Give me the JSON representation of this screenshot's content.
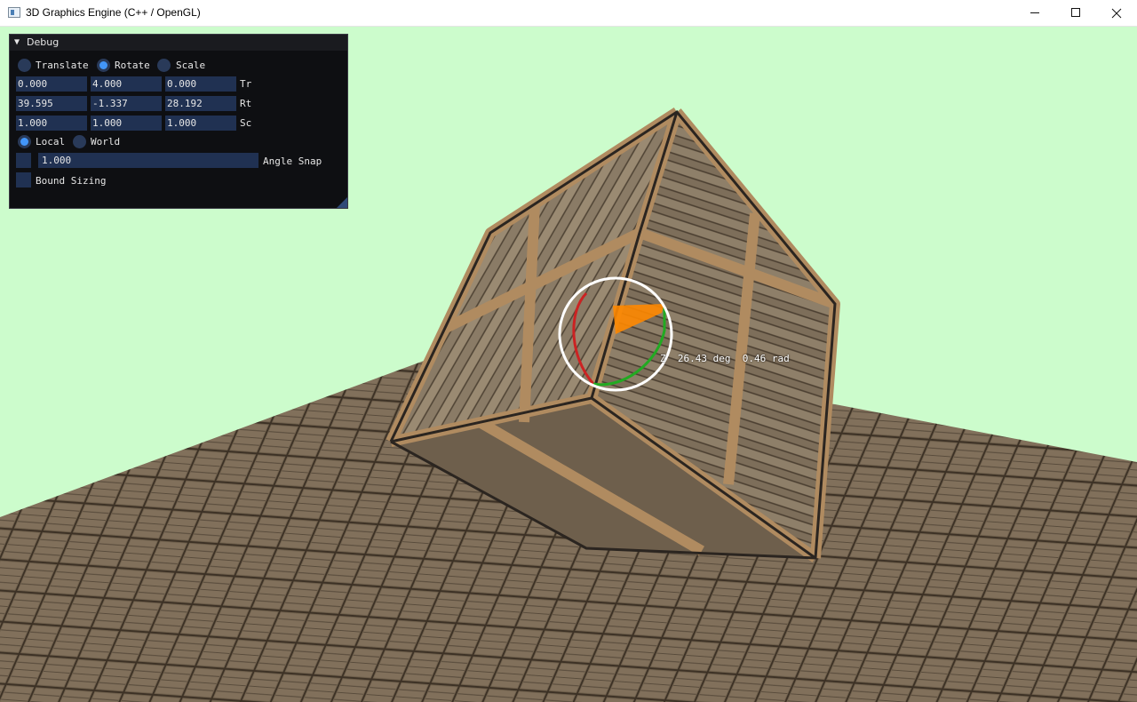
{
  "window": {
    "title": "3D Graphics Engine (C++ / OpenGL)",
    "controls": [
      "minimize",
      "maximize",
      "close"
    ]
  },
  "viewport": {
    "clear_color": "#ccfccc"
  },
  "debug_panel": {
    "title": "Debug",
    "operation_modes": [
      {
        "label": "Translate",
        "selected": false
      },
      {
        "label": "Rotate",
        "selected": true
      },
      {
        "label": "Scale",
        "selected": false
      }
    ],
    "transform_rows": [
      {
        "label": "Tr",
        "values": [
          "0.000",
          "4.000",
          "0.000"
        ]
      },
      {
        "label": "Rt",
        "values": [
          "39.595",
          "-1.337",
          "28.192"
        ]
      },
      {
        "label": "Sc",
        "values": [
          "1.000",
          "1.000",
          "1.000"
        ]
      }
    ],
    "space_modes": [
      {
        "label": "Local",
        "selected": true
      },
      {
        "label": "World",
        "selected": false
      }
    ],
    "angle_snap": {
      "label": "Angle Snap",
      "value": "1.000",
      "checked": false
    },
    "bound_sizing": {
      "label": "Bound Sizing",
      "checked": false
    },
    "accent_color": "#4296fa"
  },
  "gizmo": {
    "axis": "Z",
    "angle_deg": "26.43 deg",
    "angle_rad": "0.46 rad",
    "readout": "Z  26.43 deg  0.46 rad",
    "colors": {
      "ring": "#ffffff",
      "x": "#cc2222",
      "y": "#22aa22",
      "arc": "#ff8800"
    }
  }
}
